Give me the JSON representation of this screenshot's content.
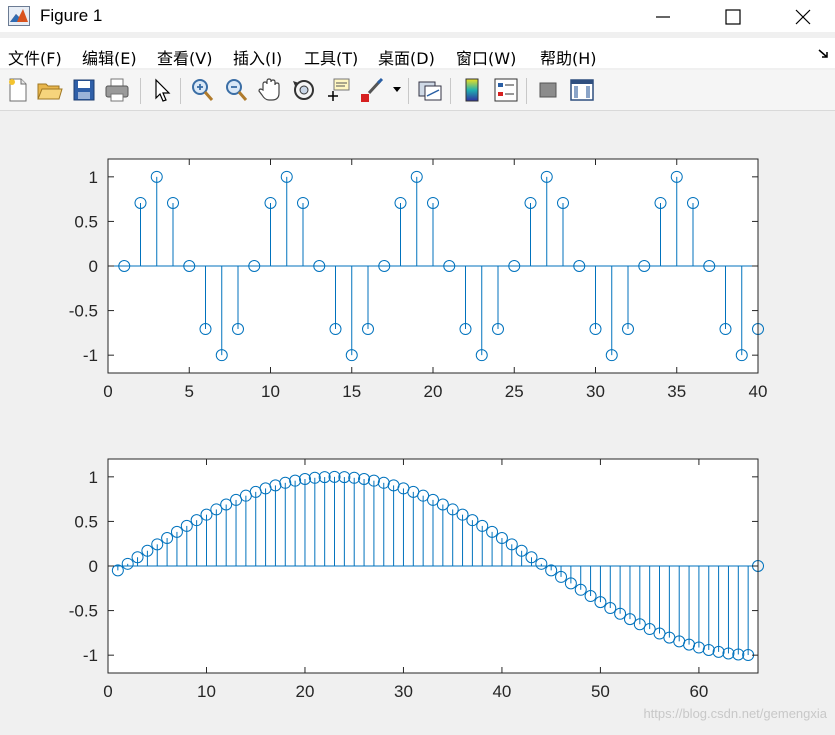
{
  "window": {
    "title": "Figure 1"
  },
  "menu": [
    {
      "label": "文件(F)"
    },
    {
      "label": "编辑(E)"
    },
    {
      "label": "查看(V)"
    },
    {
      "label": "插入(I)"
    },
    {
      "label": "工具(T)"
    },
    {
      "label": "桌面(D)"
    },
    {
      "label": "窗口(W)"
    },
    {
      "label": "帮助(H)"
    }
  ],
  "toolbar": {
    "buttons": [
      "new-figure",
      "open-file",
      "save",
      "print",
      "pointer",
      "zoom-in",
      "zoom-out",
      "pan",
      "rotate-3d",
      "data-cursor",
      "brush",
      "link-plot",
      "insert-colorbar",
      "insert-legend",
      "hide-plot-tools",
      "show-plot-tools"
    ]
  },
  "watermark": "https://blog.csdn.net/gemengxia",
  "colors": {
    "stem": "#0072bd",
    "axis": "#262626",
    "plot_bg": "#ffffff",
    "figure_bg": "#f0f0f0"
  },
  "chart_data": [
    {
      "type": "stem",
      "xlim": [
        0,
        40
      ],
      "ylim": [
        -1.2,
        1.2
      ],
      "xticks": [
        "0",
        "5",
        "10",
        "15",
        "20",
        "25",
        "30",
        "35",
        "40"
      ],
      "yticks": [
        "-1",
        "-0.5",
        "0",
        "0.5",
        "1"
      ],
      "x": [
        1,
        2,
        3,
        4,
        5,
        6,
        7,
        8,
        9,
        10,
        11,
        12,
        13,
        14,
        15,
        16,
        17,
        18,
        19,
        20,
        21,
        22,
        23,
        24,
        25,
        26,
        27,
        28,
        29,
        30,
        31,
        32,
        33,
        34,
        35,
        36,
        37,
        38,
        39,
        40
      ],
      "y": [
        0,
        0.707,
        1,
        0.707,
        0,
        -0.707,
        -1,
        -0.707,
        0,
        0.707,
        1,
        0.707,
        0,
        -0.707,
        -1,
        -0.707,
        0,
        0.707,
        1,
        0.707,
        0,
        -0.707,
        -1,
        -0.707,
        0,
        0.707,
        1,
        0.707,
        0,
        -0.707,
        -1,
        -0.707,
        0,
        0.707,
        1,
        0.707,
        0,
        -0.707,
        -1,
        -0.707
      ]
    },
    {
      "type": "stem",
      "xlim": [
        0,
        66
      ],
      "ylim": [
        -1.2,
        1.2
      ],
      "xticks": [
        "0",
        "10",
        "20",
        "30",
        "40",
        "50",
        "60"
      ],
      "yticks": [
        "-1",
        "-0.5",
        "0",
        "0.5",
        "1"
      ],
      "x": [
        1,
        2,
        3,
        4,
        5,
        6,
        7,
        8,
        9,
        10,
        11,
        12,
        13,
        14,
        15,
        16,
        17,
        18,
        19,
        20,
        21,
        22,
        23,
        24,
        25,
        26,
        27,
        28,
        29,
        30,
        31,
        32,
        33,
        34,
        35,
        36,
        37,
        38,
        39,
        40,
        41,
        42,
        43,
        44,
        45,
        46,
        47,
        48,
        49,
        50,
        51,
        52,
        53,
        54,
        55,
        56,
        57,
        58,
        59,
        60,
        61,
        62,
        63,
        64,
        65,
        66
      ],
      "y": [
        -0.0491,
        0.0245,
        0.098,
        0.171,
        0.243,
        0.3137,
        0.3827,
        0.4496,
        0.5141,
        0.5758,
        0.6344,
        0.6895,
        0.741,
        0.7886,
        0.8315,
        0.8701,
        0.904,
        0.933,
        0.9569,
        0.9757,
        0.9891,
        0.9973,
        1.0,
        0.9973,
        0.9891,
        0.9757,
        0.9569,
        0.933,
        0.904,
        0.8701,
        0.8315,
        0.7886,
        0.741,
        0.6895,
        0.6344,
        0.5758,
        0.5141,
        0.4496,
        0.3827,
        0.3137,
        0.243,
        0.171,
        0.098,
        0.0245,
        -0.0491,
        -0.1224,
        -0.1951,
        -0.2667,
        -0.3369,
        -0.4052,
        -0.4714,
        -0.5349,
        -0.5956,
        -0.6532,
        -0.7071,
        -0.7574,
        -0.8032,
        -0.8451,
        -0.8819,
        -0.9145,
        -0.9415,
        -0.9633,
        -0.9808,
        -0.9921,
        -0.9986,
        0.0
      ]
    }
  ]
}
